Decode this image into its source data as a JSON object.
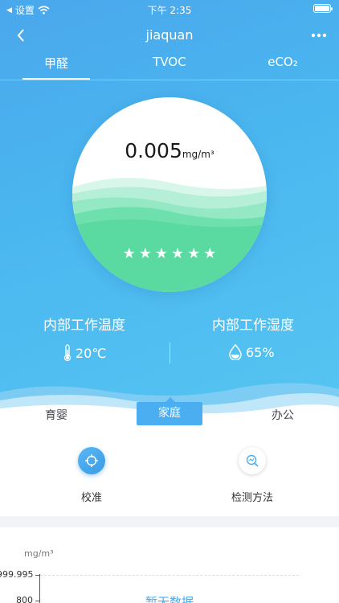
{
  "status_bar": {
    "back_app": "设置",
    "time": "下午 2:35"
  },
  "nav": {
    "title": "jiaquan"
  },
  "tabs": [
    {
      "label": "甲醛"
    },
    {
      "label": "TVOC"
    },
    {
      "label": "eCO₂"
    }
  ],
  "reading": {
    "value": "0.005",
    "unit": "mg/m³",
    "stars": 6
  },
  "environment": {
    "temp_label": "内部工作温度",
    "temp_value": "20℃",
    "humidity_label": "内部工作湿度",
    "humidity_value": "65%"
  },
  "scenes": {
    "items": [
      "育婴",
      "家庭",
      "办公"
    ],
    "selected": "家庭"
  },
  "tools": {
    "calibrate": "校准",
    "method": "检测方法"
  },
  "chart": {
    "unit": "mg/m³",
    "ticks": [
      "999.995",
      "800"
    ],
    "empty_text": "暂无数据"
  },
  "colors": {
    "accent": "#4aaef0",
    "wave_green": "#56dca0",
    "text_blue": "#49a9ee"
  }
}
